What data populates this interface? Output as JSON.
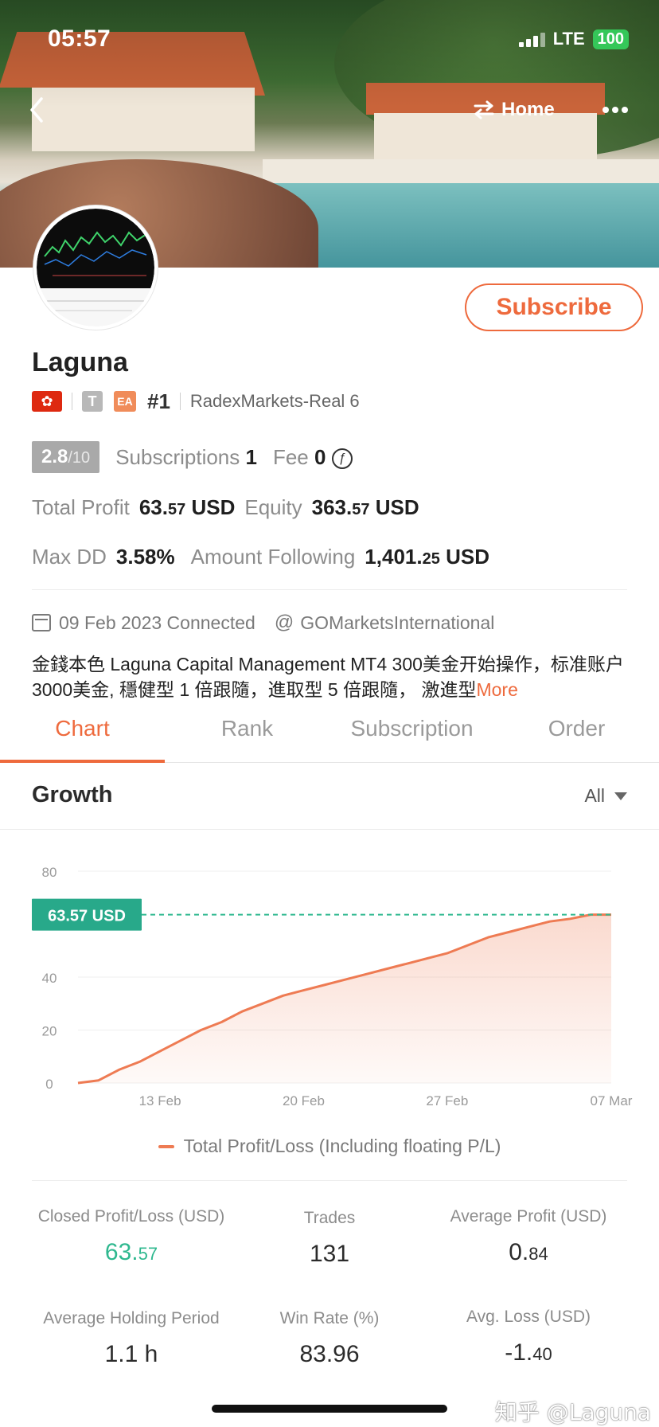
{
  "status": {
    "time": "05:57",
    "network": "LTE",
    "battery": "100"
  },
  "nav": {
    "back_icon": "chevron-left-icon",
    "home_label": "Home",
    "home_icon": "swap-icon",
    "more_icon": "more-icon"
  },
  "profile": {
    "name": "Laguna",
    "subscribe_label": "Subscribe",
    "flag_glyph": "✿",
    "tag_t": "T",
    "tag_ea": "EA",
    "rank": "#1",
    "broker": "RadexMarkets-Real 6"
  },
  "metrics": {
    "score_main": "2.8",
    "score_sub": "/10",
    "subscriptions_label": "Subscriptions",
    "subscriptions_value": "1",
    "fee_label": "Fee",
    "fee_value": "0",
    "total_profit_label": "Total Profit",
    "total_profit_int": "63.",
    "total_profit_dec": "57",
    "total_profit_unit": "USD",
    "equity_label": "Equity",
    "equity_int": "363.",
    "equity_dec": "57",
    "equity_unit": "USD",
    "max_dd_label": "Max DD",
    "max_dd_value": "3.58%",
    "amount_following_label": "Amount Following",
    "amount_following_int": "1,401.",
    "amount_following_dec": "25",
    "amount_following_unit": "USD"
  },
  "meta": {
    "connected": "09 Feb 2023 Connected",
    "at_symbol": "@",
    "account": "GOMarketsInternational",
    "description": "金錢本色 Laguna Capital Management MT4 300美金开始操作，标准账户 3000美金, 穩健型 1 倍跟隨，進取型 5 倍跟隨， 激進型",
    "more_label": "More"
  },
  "tabs": [
    "Chart",
    "Rank",
    "Subscription",
    "Order"
  ],
  "growth": {
    "title": "Growth",
    "range": "All"
  },
  "chart_data": {
    "type": "area",
    "ylim": [
      0,
      80
    ],
    "y_ticks": [
      "0",
      "20",
      "40",
      "80"
    ],
    "x_ticks": [
      "13 Feb",
      "20 Feb",
      "27 Feb",
      "07 Mar"
    ],
    "current_label": "63.57 USD",
    "current_value": 63.57,
    "series": [
      {
        "name": "Total Profit/Loss (Including floating P/L)",
        "color": "#ee7b53",
        "x": [
          "09 Feb",
          "10 Feb",
          "11 Feb",
          "12 Feb",
          "13 Feb",
          "14 Feb",
          "15 Feb",
          "16 Feb",
          "17 Feb",
          "18 Feb",
          "19 Feb",
          "20 Feb",
          "21 Feb",
          "22 Feb",
          "23 Feb",
          "24 Feb",
          "25 Feb",
          "26 Feb",
          "27 Feb",
          "28 Feb",
          "01 Mar",
          "02 Mar",
          "03 Mar",
          "04 Mar",
          "05 Mar",
          "06 Mar",
          "07 Mar"
        ],
        "values": [
          0,
          1,
          5,
          8,
          12,
          16,
          20,
          23,
          27,
          30,
          33,
          35,
          37,
          39,
          41,
          43,
          45,
          47,
          49,
          52,
          55,
          57,
          59,
          61,
          62,
          63.57,
          63.57
        ]
      }
    ]
  },
  "legend": {
    "label": "Total Profit/Loss (Including floating P/L)"
  },
  "stats": {
    "closed_label": "Closed Profit/Loss (USD)",
    "closed_int": "63.",
    "closed_dec": "57",
    "trades_label": "Trades",
    "trades_value": "131",
    "avg_profit_label": "Average Profit (USD)",
    "avg_profit_int": "0.",
    "avg_profit_dec": "84",
    "holding_label": "Average Holding Period",
    "holding_value": "1.1 h",
    "win_rate_label": "Win Rate (%)",
    "win_rate_value": "83.96",
    "avg_loss_label": "Avg. Loss (USD)",
    "avg_loss_int": "-1.",
    "avg_loss_dec": "40"
  },
  "watermark": "知乎 @Laguna"
}
